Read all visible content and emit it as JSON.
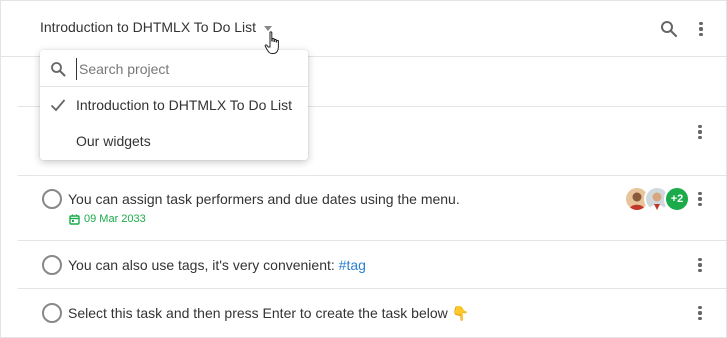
{
  "toolbar": {
    "project_title": "Introduction to DHTMLX To Do List",
    "search_icon": "search-icon",
    "menu_icon": "more-vertical-icon"
  },
  "project_menu": {
    "search_placeholder": "Search project",
    "search_value": "",
    "items": [
      {
        "label": "Introduction to DHTMLX To Do List",
        "selected": true
      },
      {
        "label": "Our widgets",
        "selected": false
      }
    ]
  },
  "tasks": [
    {
      "text": "You can assign task performers and due dates using the menu.",
      "due_date": "09 Mar 2033",
      "assignees_more": "+2"
    },
    {
      "text_before_tag": "You can also use tags, it's very convenient: ",
      "tag": "#tag"
    },
    {
      "text": "Select this task and then press Enter to create the task below",
      "emoji": "👇"
    }
  ],
  "colors": {
    "accent_green": "#1bab4a",
    "tag_blue": "#2b7fd0",
    "border": "#e4e4e4"
  }
}
